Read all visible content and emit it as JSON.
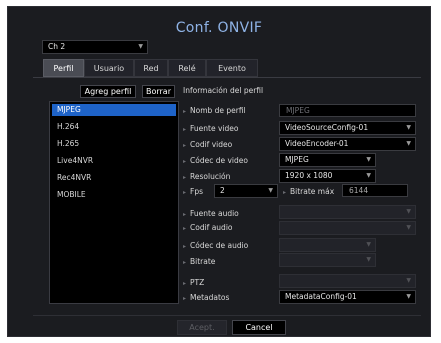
{
  "window": {
    "title": "Conf. ONVIF"
  },
  "channel_select": {
    "value": "Ch 2"
  },
  "tabs": [
    {
      "label": "Perfil",
      "active": true
    },
    {
      "label": "Usuario",
      "active": false
    },
    {
      "label": "Red",
      "active": false
    },
    {
      "label": "Relé",
      "active": false
    },
    {
      "label": "Evento",
      "active": false
    }
  ],
  "actions": {
    "add_profile": "Agreg perfil",
    "delete": "Borrar"
  },
  "profile_info": {
    "heading": "Información del perfil"
  },
  "profiles": [
    "MJPEG",
    "H.264",
    "H.265",
    "Live4NVR",
    "Rec4NVR",
    "MOBILE"
  ],
  "fields": {
    "profile_name": {
      "label": "Nomb de perfil",
      "placeholder": "MJPEG"
    },
    "video_source": {
      "label": "Fuente video",
      "value": "VideoSourceConfig-01"
    },
    "video_encoder": {
      "label": "Codif video",
      "value": "VideoEncoder-01"
    },
    "video_codec": {
      "label": "Códec de video",
      "value": "MJPEG"
    },
    "resolution": {
      "label": "Resolución",
      "value": "1920 x 1080"
    },
    "fps": {
      "label": "Fps",
      "value": "2"
    },
    "bitrate_max": {
      "label": "Bitrate máx",
      "value": "6144"
    },
    "audio_source": {
      "label": "Fuente audio",
      "value": ""
    },
    "audio_encoder": {
      "label": "Codif audio",
      "value": ""
    },
    "audio_codec": {
      "label": "Códec de audio",
      "value": ""
    },
    "bitrate": {
      "label": "Bitrate",
      "value": ""
    },
    "ptz": {
      "label": "PTZ",
      "value": ""
    },
    "metadata": {
      "label": "Metadatos",
      "value": "MetadataConfig-01"
    }
  },
  "footer": {
    "accept": "Acept.",
    "cancel": "Cancel"
  },
  "colors": {
    "accent": "#1e63c8",
    "title": "#8fb3e6",
    "background": "#1b1c20"
  }
}
